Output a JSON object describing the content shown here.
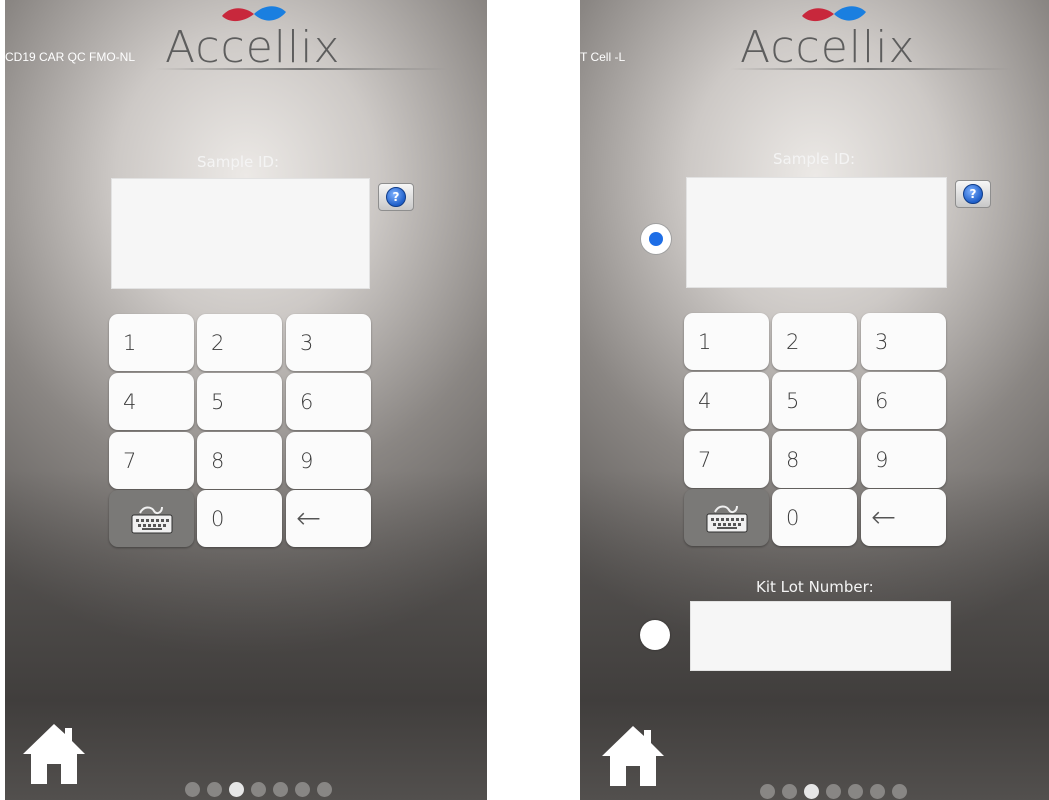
{
  "screens": [
    {
      "context_label": "CD19 CAR QC FMO-NL",
      "logo_text": "Accellix",
      "sample_id_label": "Sample ID:",
      "sample_id_value": "",
      "help_symbol": "?",
      "keys": [
        "1",
        "2",
        "3",
        "4",
        "5",
        "6",
        "7",
        "8",
        "9",
        "keyboard",
        "0",
        "←"
      ],
      "page_indicator": {
        "total": 7,
        "active": 3
      }
    },
    {
      "context_label": "T Cell -L",
      "logo_text": "Accellix",
      "sample_id_label": "Sample ID:",
      "sample_id_value": "",
      "help_symbol": "?",
      "keys": [
        "1",
        "2",
        "3",
        "4",
        "5",
        "6",
        "7",
        "8",
        "9",
        "keyboard",
        "0",
        "←"
      ],
      "kit_lot_label": "Kit Lot Number:",
      "kit_lot_value": "",
      "sample_id_radio_selected": true,
      "kit_lot_radio_selected": false,
      "page_indicator": {
        "total": 7,
        "active": 3
      }
    }
  ],
  "colors": {
    "accent_blue": "#1e6ee6",
    "logo_red": "#c8283c",
    "logo_blue": "#1a7fe0",
    "logo_text": "#5d5d5d"
  },
  "icons": {
    "help": "help-icon",
    "keyboard": "keyboard-icon",
    "home": "home-icon"
  }
}
